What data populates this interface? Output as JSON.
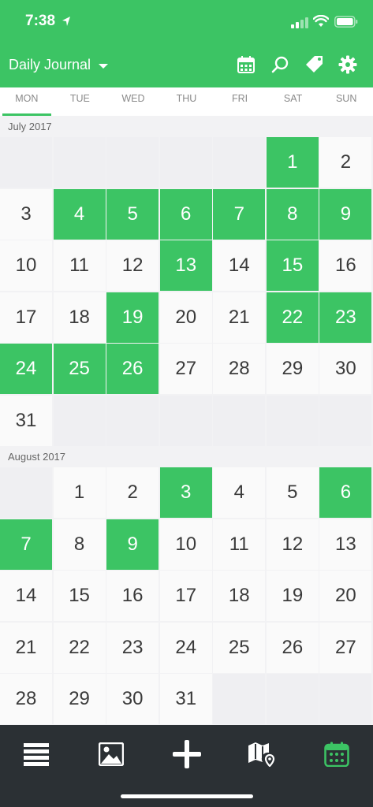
{
  "status": {
    "time": "7:38"
  },
  "header": {
    "title": "Daily Journal"
  },
  "weekdays": [
    "MON",
    "TUE",
    "WED",
    "THU",
    "FRI",
    "SAT",
    "SUN"
  ],
  "months": [
    {
      "label": "July 2017",
      "lead_empty": 5,
      "days": 31,
      "marked": [
        1,
        4,
        5,
        6,
        7,
        8,
        9,
        13,
        15,
        19,
        22,
        23,
        24,
        25,
        26
      ]
    },
    {
      "label": "August 2017",
      "lead_empty": 1,
      "days": 31,
      "marked": [
        3,
        6,
        7,
        9
      ]
    }
  ],
  "colors": {
    "accent": "#3cc464",
    "tabbar": "#2b3034"
  },
  "tabs": [
    "list-icon",
    "photos-icon",
    "add-icon",
    "map-icon",
    "calendar-icon"
  ]
}
